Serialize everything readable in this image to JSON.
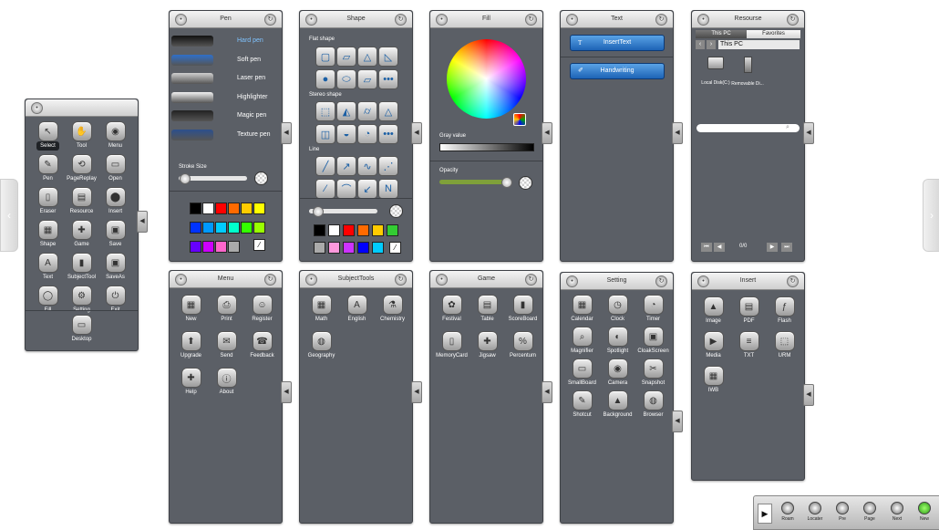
{
  "nav": {
    "left_arrow": "‹",
    "right_arrow": "›"
  },
  "main_toolbar": {
    "items": [
      {
        "label": "Select",
        "glyph": "↖"
      },
      {
        "label": "Tool",
        "glyph": "✋"
      },
      {
        "label": "Menu",
        "glyph": "◉"
      },
      {
        "label": "Pen",
        "glyph": "✎"
      },
      {
        "label": "PageReplay",
        "glyph": "⟲"
      },
      {
        "label": "Open",
        "glyph": "▭"
      },
      {
        "label": "Eraser",
        "glyph": "▯"
      },
      {
        "label": "Resource",
        "glyph": "▤"
      },
      {
        "label": "Insert",
        "glyph": "⬤"
      },
      {
        "label": "Shape",
        "glyph": "▦"
      },
      {
        "label": "Game",
        "glyph": "✚"
      },
      {
        "label": "Save",
        "glyph": "▣"
      },
      {
        "label": "Text",
        "glyph": "A"
      },
      {
        "label": "SubjectTool",
        "glyph": "▮"
      },
      {
        "label": "SaveAs",
        "glyph": "▣"
      },
      {
        "label": "Fill",
        "glyph": "◯"
      },
      {
        "label": "Setting",
        "glyph": "⚙"
      },
      {
        "label": "Exit",
        "glyph": "⏻"
      },
      {
        "label": "Desktop",
        "glyph": "▭"
      }
    ]
  },
  "pen": {
    "title": "Pen",
    "pens": [
      {
        "label": "Hard pen",
        "color": "#111111",
        "selected": true
      },
      {
        "label": "Soft pen",
        "color": "#2f6fc9",
        "selected": false
      },
      {
        "label": "Laser pen",
        "color": "#cfcfcf",
        "selected": false
      },
      {
        "label": "Highlighter",
        "color": "#f2f2f2",
        "selected": false
      },
      {
        "label": "Magic pen",
        "color": "#222222",
        "selected": false
      },
      {
        "label": "Texture pen",
        "color": "#2c4f8d",
        "selected": false
      }
    ],
    "stroke_label": "Stroke Size",
    "stroke_value": 0.05,
    "colors": [
      "#000000",
      "#ffffff",
      "#ff0000",
      "#ff6a00",
      "#ffcc00",
      "#ffff00",
      "#0033ff",
      "#0099ff",
      "#00ccff",
      "#00ffcc",
      "#33ff00",
      "#99ff00",
      "#6600ff",
      "#cc00ff",
      "#ff66cc",
      "#aaaaaa"
    ]
  },
  "shape": {
    "title": "Shape",
    "flat_label": "Flat shape",
    "flat": [
      "▢",
      "▱",
      "△",
      "◺",
      "●",
      "⬭",
      "▱",
      "•••"
    ],
    "stereo_label": "Stereo shape",
    "stereo": [
      "⬚",
      "◭",
      "⌭",
      "△",
      "◫",
      "◒",
      "◔",
      "•••"
    ],
    "line_label": "Line",
    "lines": [
      "╱",
      "↗",
      "∿",
      "⋰",
      "⁄",
      "⌒",
      "↙",
      "N"
    ],
    "thickness_value": 0.1,
    "colors": [
      "#000000",
      "#ffffff",
      "#ff0000",
      "#ff6a00",
      "#ffcc00",
      "#33cc33",
      "#aaaaaa",
      "#ff99dd",
      "#cc33ff",
      "#0000ff",
      "#00ccff"
    ]
  },
  "fill": {
    "title": "Fill",
    "gray_label": "Gray value",
    "opacity_label": "Opacity",
    "opacity_value": 0.95
  },
  "text": {
    "title": "Text",
    "insert_text": "InsertText",
    "insert_glyph": "T",
    "handwriting": "Handwriting",
    "handwriting_glyph": "✐"
  },
  "resource": {
    "title": "Resourse",
    "tab_this_pc": "This PC",
    "tab_favorites": "Favorites",
    "path": "This PC",
    "drives": [
      {
        "label": "Local Disk(C:)"
      },
      {
        "label": "Removable Di..."
      }
    ],
    "page_indicator": "0/0"
  },
  "menu": {
    "title": "Menu",
    "items": [
      {
        "label": "New",
        "glyph": "▦"
      },
      {
        "label": "Print",
        "glyph": "⎙"
      },
      {
        "label": "Register",
        "glyph": "☺"
      },
      {
        "label": "Upgrade",
        "glyph": "⬆"
      },
      {
        "label": "Send",
        "glyph": "✉"
      },
      {
        "label": "Feedback",
        "glyph": "☎"
      },
      {
        "label": "Help",
        "glyph": "✚"
      },
      {
        "label": "About",
        "glyph": "ⓘ"
      }
    ]
  },
  "subject": {
    "title": "SubjectTools",
    "items": [
      {
        "label": "Math",
        "glyph": "▦"
      },
      {
        "label": "English",
        "glyph": "A"
      },
      {
        "label": "Chemistry",
        "glyph": "⚗"
      },
      {
        "label": "Geography",
        "glyph": "◍"
      }
    ]
  },
  "game": {
    "title": "Game",
    "items": [
      {
        "label": "Festival",
        "glyph": "✿"
      },
      {
        "label": "Table",
        "glyph": "▤"
      },
      {
        "label": "ScoreBoard",
        "glyph": "▮"
      },
      {
        "label": "MemoryCard",
        "glyph": "▯"
      },
      {
        "label": "Jigsaw",
        "glyph": "✚"
      },
      {
        "label": "Percentum",
        "glyph": "%"
      }
    ]
  },
  "setting": {
    "title": "Setting",
    "items": [
      {
        "label": "Calendar",
        "glyph": "▦"
      },
      {
        "label": "Clock",
        "glyph": "◷"
      },
      {
        "label": "Timer",
        "glyph": "◔"
      },
      {
        "label": "Magnifier",
        "glyph": "⌕"
      },
      {
        "label": "Spotlight",
        "glyph": "◐"
      },
      {
        "label": "CloakScreen",
        "glyph": "▣"
      },
      {
        "label": "SmallBoard",
        "glyph": "▭"
      },
      {
        "label": "Camera",
        "glyph": "◉"
      },
      {
        "label": "Snapshot",
        "glyph": "✂"
      },
      {
        "label": "Shotcut",
        "glyph": "✎"
      },
      {
        "label": "Background",
        "glyph": "▲"
      },
      {
        "label": "Browser",
        "glyph": "◍"
      }
    ]
  },
  "insert": {
    "title": "Insert",
    "items": [
      {
        "label": "Image",
        "glyph": "▲"
      },
      {
        "label": "PDF",
        "glyph": "▤"
      },
      {
        "label": "Flash",
        "glyph": "ƒ"
      },
      {
        "label": "Media",
        "glyph": "▶"
      },
      {
        "label": "TXT",
        "glyph": "≡"
      },
      {
        "label": "URM",
        "glyph": "⬚"
      },
      {
        "label": "IWB",
        "glyph": "▦"
      }
    ]
  },
  "bottom": {
    "toggle": "▶",
    "items": [
      {
        "label": "Roam"
      },
      {
        "label": "Locater"
      },
      {
        "label": "Pre"
      },
      {
        "label": "Page"
      },
      {
        "label": "Next"
      },
      {
        "label": "New"
      }
    ]
  }
}
